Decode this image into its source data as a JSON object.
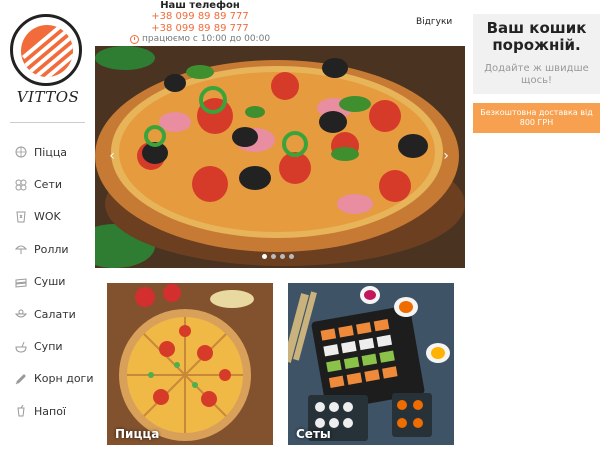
{
  "brand": {
    "name": "VITTOS"
  },
  "header": {
    "phone_title": "Наш телефон",
    "phones": [
      "+38 099 89 89 777",
      "+38 099 89 89 777"
    ],
    "hours": "працюємо с 10:00 до 00:00",
    "reviews_label": "Відгуки"
  },
  "sidebar": {
    "items": [
      {
        "label": "Піцца",
        "icon": "pizza-icon"
      },
      {
        "label": "Сети",
        "icon": "set-icon"
      },
      {
        "label": "WOK",
        "icon": "wok-icon"
      },
      {
        "label": "Ролли",
        "icon": "roll-icon"
      },
      {
        "label": "Суши",
        "icon": "sushi-icon"
      },
      {
        "label": "Салати",
        "icon": "salad-icon"
      },
      {
        "label": "Супи",
        "icon": "soup-icon"
      },
      {
        "label": "Корн доги",
        "icon": "corndog-icon"
      },
      {
        "label": "Напої",
        "icon": "drink-icon"
      }
    ]
  },
  "carousel": {
    "slide_count": 4,
    "active_slide": 1,
    "prev_icon": "chevron-left-icon",
    "next_icon": "chevron-right-icon"
  },
  "tiles": [
    {
      "label": "Пицца"
    },
    {
      "label": "Сеты"
    }
  ],
  "cart": {
    "title": "Ваш кошик порожній.",
    "subtitle": "Додайте ж швидше щось!"
  },
  "delivery_banner": "Безкоштовна доставка від 800 ГРН",
  "colors": {
    "accent": "#f26b3a",
    "delivery_bg": "#f7a150",
    "cart_bg": "#f1f1f1"
  }
}
